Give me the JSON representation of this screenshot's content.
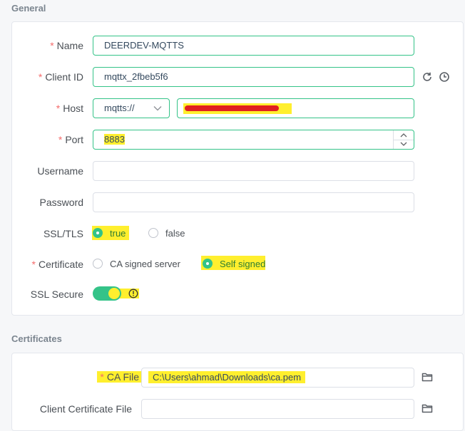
{
  "sections": {
    "general": "General",
    "certificates": "Certificates"
  },
  "fields": {
    "name": {
      "label": "Name",
      "value": "DEERDEV-MQTTS"
    },
    "client_id": {
      "label": "Client ID",
      "value": "mqttx_2fbeb5f6"
    },
    "host": {
      "label": "Host",
      "protocol": "mqtts://",
      "value": ""
    },
    "port": {
      "label": "Port",
      "value": "8883"
    },
    "username": {
      "label": "Username",
      "value": ""
    },
    "password": {
      "label": "Password",
      "value": ""
    },
    "ssl_tls": {
      "label": "SSL/TLS",
      "option_true": "true",
      "option_false": "false",
      "selected": "true"
    },
    "certificate": {
      "label": "Certificate",
      "option_ca": "CA signed server",
      "option_self": "Self signed",
      "selected": "Self signed"
    },
    "ssl_secure": {
      "label": "SSL Secure",
      "on": true
    },
    "ca_file": {
      "label": "CA File",
      "value": "C:\\Users\\ahmad\\Downloads\\ca.pem"
    },
    "client_cert": {
      "label": "Client Certificate File",
      "value": ""
    }
  },
  "icons": {
    "refresh": "refresh-icon",
    "history": "clock-icon",
    "info": "info-icon",
    "folder": "folder-icon",
    "chevron": "chevron-down-icon"
  },
  "colors": {
    "accent": "#34c388",
    "required": "#f56c6c",
    "highlight": "#ffef2e",
    "redaction": "#e02020"
  }
}
